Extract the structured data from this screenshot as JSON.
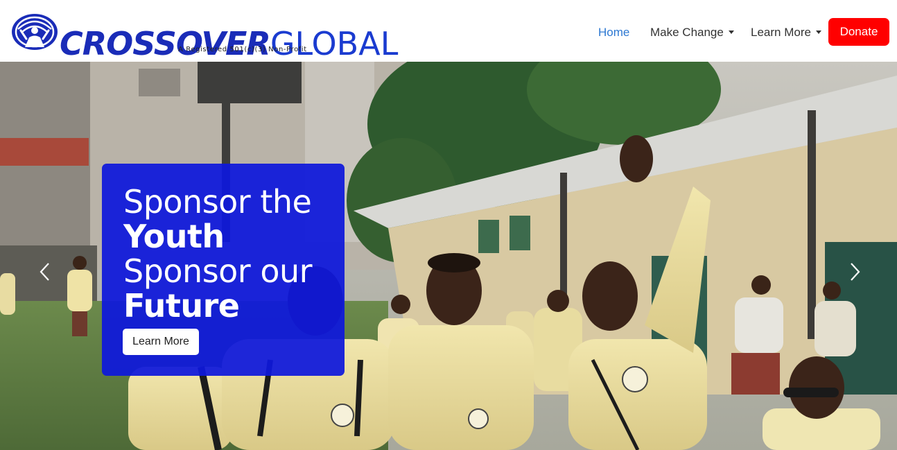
{
  "brand": {
    "name_bold": "CROSSOVER",
    "name_light": "GLOBAL",
    "tagline": "A Registered 501(c)(3) Non-Profit",
    "primary_color": "#1a2cb8"
  },
  "nav": {
    "items": [
      {
        "label": "Home",
        "active": true
      },
      {
        "label": "Make Change",
        "dropdown": true
      },
      {
        "label": "Learn More",
        "dropdown": true
      }
    ],
    "donate_label": "Donate",
    "donate_color": "#ff0000",
    "active_color": "#2d78d2"
  },
  "hero": {
    "line1": "Sponsor the",
    "line2": "Youth",
    "line3": "Sponsor our",
    "line4": "Future",
    "button_label": "Learn More",
    "card_color": "#0e18dc",
    "prev_icon": "chevron-left-icon",
    "next_icon": "chevron-right-icon"
  }
}
